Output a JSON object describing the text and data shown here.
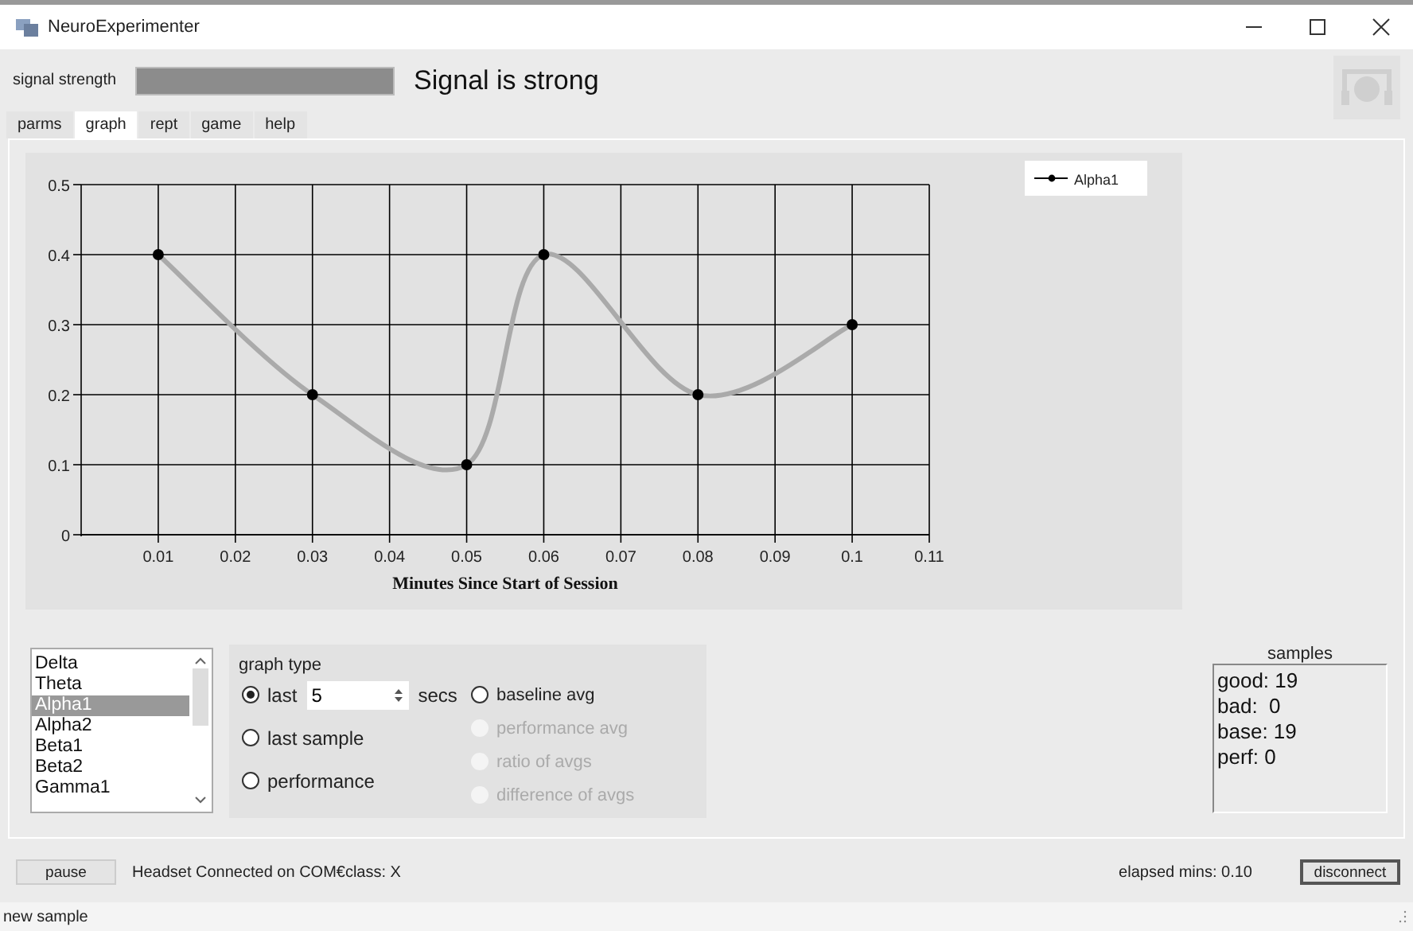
{
  "window": {
    "title": "NeuroExperimenter"
  },
  "signal": {
    "label": "signal strength",
    "level": 1,
    "message": "Signal is strong"
  },
  "tabs": [
    {
      "label": "parms",
      "selected": false
    },
    {
      "label": "graph",
      "selected": true
    },
    {
      "label": "rept",
      "selected": false
    },
    {
      "label": "game",
      "selected": false
    },
    {
      "label": "help",
      "selected": false
    }
  ],
  "chart": {
    "chart_data": {
      "type": "line",
      "grid": true,
      "xlabel": "Minutes Since Start of Session",
      "xlim": [
        0,
        0.11
      ],
      "ylim": [
        0,
        0.5
      ],
      "xticks": [
        0.01,
        0.02,
        0.03,
        0.04,
        0.05,
        0.06,
        0.07,
        0.08,
        0.09,
        0.1,
        0.11
      ],
      "yticks": [
        0,
        0.1,
        0.2,
        0.3,
        0.4,
        0.5
      ],
      "x": [
        0.01,
        0.03,
        0.05,
        0.06,
        0.08,
        0.1
      ],
      "series": [
        {
          "name": "Alpha1",
          "color": "#aaaaaa",
          "marker": "circle",
          "values": [
            0.4,
            0.2,
            0.1,
            0.4,
            0.2,
            0.3
          ]
        }
      ]
    }
  },
  "bands": [
    {
      "label": "Delta",
      "selected": false
    },
    {
      "label": "Theta",
      "selected": false
    },
    {
      "label": "Alpha1",
      "selected": true
    },
    {
      "label": "Alpha2",
      "selected": false
    },
    {
      "label": "Beta1",
      "selected": false
    },
    {
      "label": "Beta2",
      "selected": false
    },
    {
      "label": "Gamma1",
      "selected": false
    }
  ],
  "graph_type": {
    "title": "graph type",
    "options": [
      {
        "label": "last",
        "selected": true,
        "disabled": false,
        "spin_value": "5",
        "unit": "secs"
      },
      {
        "label": "last sample",
        "selected": false,
        "disabled": false
      },
      {
        "label": "performance",
        "selected": false,
        "disabled": false
      },
      {
        "label": "baseline avg",
        "selected": false,
        "disabled": false
      },
      {
        "label": "performance avg",
        "selected": false,
        "disabled": true
      },
      {
        "label": "ratio of avgs",
        "selected": false,
        "disabled": true
      },
      {
        "label": "difference of avgs",
        "selected": false,
        "disabled": true
      }
    ]
  },
  "samples": {
    "title": "samples",
    "lines": [
      "good: 19",
      "bad:  0",
      "base: 19",
      "perf: 0"
    ]
  },
  "footer": {
    "pause": "pause",
    "status": "Headset Connected on COM€class: X",
    "elapsed": "elapsed mins: 0.10",
    "disconnect": "disconnect"
  },
  "status_bar": "new sample"
}
